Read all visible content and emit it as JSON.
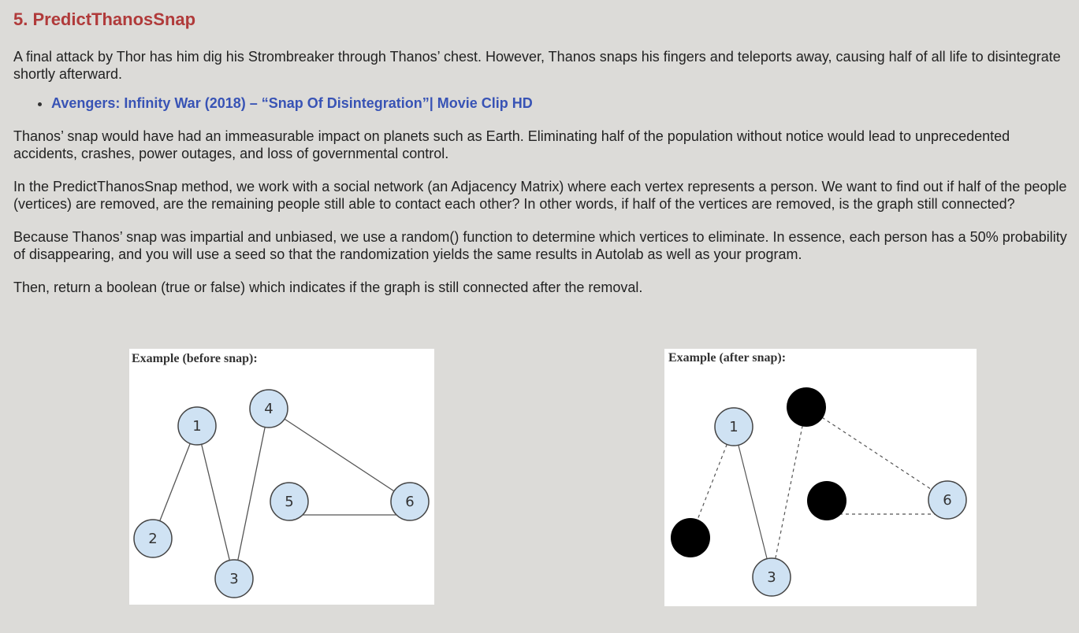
{
  "section": {
    "title": "5. PredictThanosSnap",
    "paragraphs": [
      "A final attack by Thor has him dig his Strombreaker through Thanos’ chest. However, Thanos snaps his fingers and teleports away, causing half of all life to disintegrate shortly afterward.",
      "Thanos’ snap would have had an immeasurable impact on planets such as Earth. Eliminating half of the population without notice would lead to unprecedented accidents, crashes, power outages, and loss of governmental control.",
      "In the PredictThanosSnap method, we work with a social network (an Adjacency Matrix) where each vertex represents a person. We want to find out if half of the people (vertices) are removed, are the remaining people still able to contact each other? In other words, if half of the vertices are removed, is the graph still connected?",
      "Because Thanos’ snap was impartial and unbiased, we use a random() function to determine which vertices to eliminate. In essence, each person has a 50% probability of disappearing, and you will use a seed so that the randomization yields the same results in Autolab as well as your program.",
      "Then, return a boolean (true or false) which indicates if the graph is still connected after the removal."
    ],
    "link": {
      "label": "Avengers: Infinity War (2018) – “Snap Of Disintegration”| Movie Clip HD"
    }
  },
  "figures": {
    "before": {
      "caption": "Example (before snap):",
      "node_labels": {
        "n1": "1",
        "n2": "2",
        "n3": "3",
        "n4": "4",
        "n5": "5",
        "n6": "6"
      }
    },
    "after": {
      "caption": "Example (after snap):",
      "node_labels": {
        "n1": "1",
        "n3": "3",
        "n6": "6"
      }
    }
  },
  "colors": {
    "heading": "#b03a3a",
    "link": "#3853b5",
    "node_fill": "#cfe2f3",
    "removed_node": "#000000",
    "background": "#dcdbd8"
  }
}
